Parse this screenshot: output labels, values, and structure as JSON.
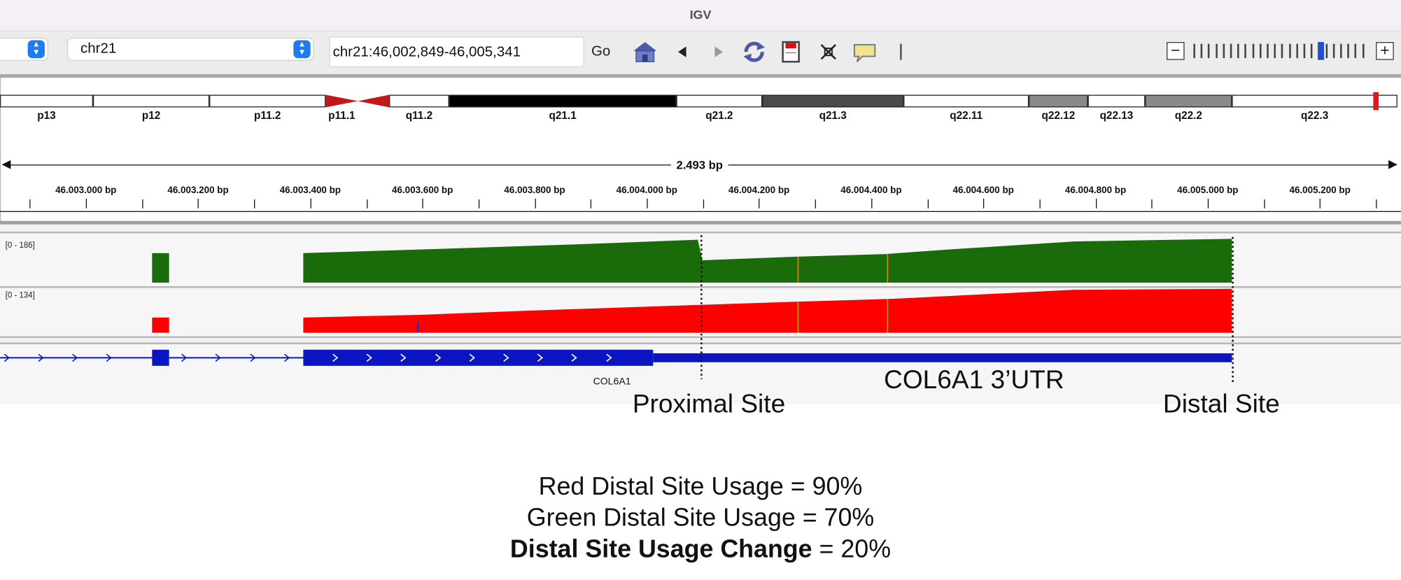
{
  "window": {
    "title": "IGV"
  },
  "toolbar": {
    "genome_value": "",
    "chromosome_value": "chr21",
    "locus_value": "chr21:46,002,849-46,005,341",
    "go_label": "Go",
    "icons": [
      "home-icon",
      "back-icon",
      "forward-icon",
      "refresh-icon",
      "roi-icon",
      "resize-icon",
      "popup-info-icon",
      "separator"
    ],
    "zoom": {
      "levels": 24,
      "current": 17
    }
  },
  "ideogram": {
    "bands": [
      {
        "name": "p13",
        "start": 0,
        "end": 104,
        "stain": "gneg"
      },
      {
        "name": "p12",
        "start": 104,
        "end": 234,
        "stain": "gneg"
      },
      {
        "name": "p11.2",
        "start": 234,
        "end": 364,
        "stain": "gneg"
      },
      {
        "name": "p11.1",
        "start": 364,
        "end": 400,
        "stain": "acen"
      },
      {
        "name": "",
        "start": 400,
        "end": 435,
        "stain": "acen"
      },
      {
        "name": "q11.2",
        "start": 435,
        "end": 502,
        "stain": "gneg"
      },
      {
        "name": "q21.1",
        "start": 502,
        "end": 756,
        "stain": "gpos100"
      },
      {
        "name": "q21.2",
        "start": 756,
        "end": 852,
        "stain": "gneg"
      },
      {
        "name": "q21.3",
        "start": 852,
        "end": 1010,
        "stain": "gpos75"
      },
      {
        "name": "q22.11",
        "start": 1010,
        "end": 1150,
        "stain": "gneg"
      },
      {
        "name": "q22.12",
        "start": 1150,
        "end": 1216,
        "stain": "gpos50"
      },
      {
        "name": "q22.13",
        "start": 1216,
        "end": 1280,
        "stain": "gneg"
      },
      {
        "name": "q22.2",
        "start": 1280,
        "end": 1377,
        "stain": "gpos50"
      },
      {
        "name": "q22.3",
        "start": 1377,
        "end": 1562,
        "stain": "gneg"
      }
    ],
    "current_region_color": "#e8141c"
  },
  "ruler": {
    "span_label": "2.493 bp",
    "tick_labels": [
      "46.003.000 bp",
      "46.003.200 bp",
      "46.003.400 bp",
      "46.003.600 bp",
      "46.003.800 bp",
      "46.004.000 bp",
      "46.004.200 bp",
      "46.004.400 bp",
      "46.004.600 bp",
      "46.004.800 bp",
      "46.005.000 bp",
      "46.005.200 bp"
    ]
  },
  "tracks": [
    {
      "range": "[0 - 186]",
      "color": "#1a6b0a"
    },
    {
      "range": "[0 - 134]",
      "color": "#ff0000"
    }
  ],
  "gene": {
    "name": "COL6A1",
    "color": "#0b16c2"
  },
  "annotations": {
    "utr_label": "COL6A1 3’UTR",
    "proximal_label": "Proximal Site",
    "distal_label": "Distal Site"
  },
  "summary": {
    "red_usage": "Red Distal Site Usage = 90%",
    "green_usage": "Green Distal Site Usage = 70%",
    "change_bold": "Distal Site Usage Change",
    "change_value": " = 20%"
  }
}
